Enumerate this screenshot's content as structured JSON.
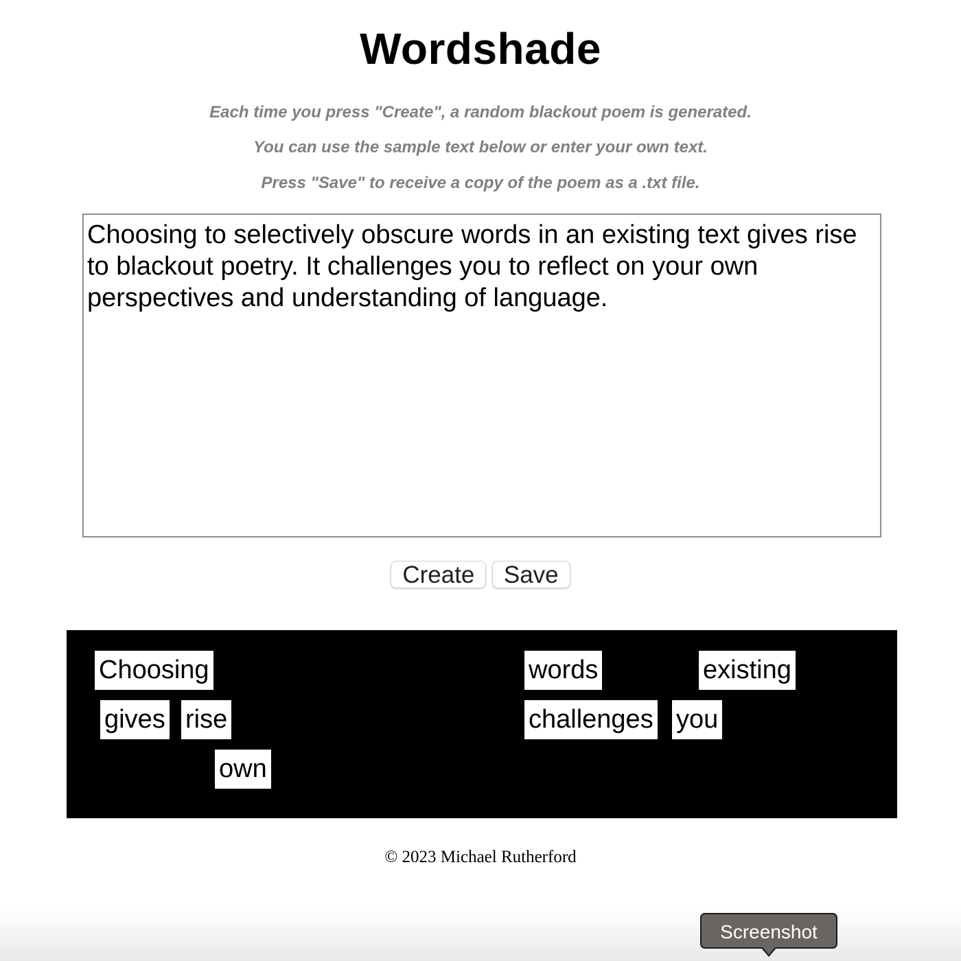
{
  "header": {
    "title": "Wordshade"
  },
  "instructions": [
    "Each time you press \"Create\", a random blackout poem is generated.",
    "You can use the sample text below or enter your own text.",
    "Press \"Save\" to receive a copy of the poem as a .txt file."
  ],
  "input": {
    "value": "Choosing to selectively obscure words in an existing text gives rise to blackout poetry. It challenges you to reflect on your own perspectives and understanding of language."
  },
  "buttons": {
    "create_label": "Create",
    "save_label": "Save"
  },
  "poem": {
    "words": [
      "Choosing",
      "words",
      "existing",
      "gives",
      "rise",
      "challenges",
      "you",
      "own"
    ]
  },
  "footer": {
    "copyright": "© 2023 Michael Rutherford"
  },
  "tooltip": {
    "label": "Screenshot"
  },
  "colors": {
    "poem_background": "#000000",
    "word_highlight": "#ffffff",
    "instruction_text": "#808080"
  }
}
